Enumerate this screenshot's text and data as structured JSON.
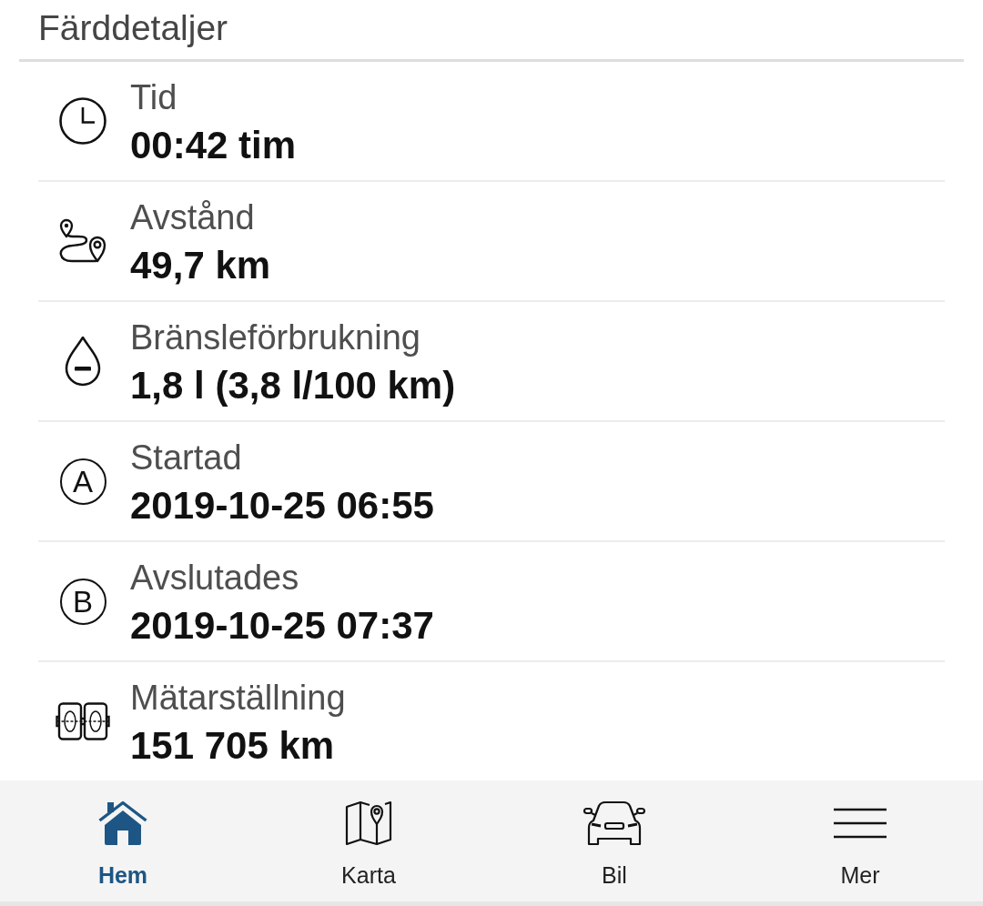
{
  "header": {
    "title": "Färddetaljer"
  },
  "details": [
    {
      "kind": "clock",
      "label": "Tid",
      "value": "00:42 tim"
    },
    {
      "kind": "route",
      "label": "Avstånd",
      "value": "49,7 km"
    },
    {
      "kind": "fuel",
      "label": "Bränsleförbrukning",
      "value": "1,8 l (3,8 l/100 km)"
    },
    {
      "kind": "marker",
      "marker": "A",
      "label": "Startad",
      "value": "2019-10-25 06:55"
    },
    {
      "kind": "marker",
      "marker": "B",
      "label": "Avslutades",
      "value": "2019-10-25 07:37"
    },
    {
      "kind": "odometer",
      "label": "Mätarställning",
      "value": "151 705 km"
    }
  ],
  "nav": [
    {
      "kind": "home",
      "label": "Hem",
      "selected": true
    },
    {
      "kind": "map",
      "label": "Karta",
      "selected": false
    },
    {
      "kind": "car",
      "label": "Bil",
      "selected": false
    },
    {
      "kind": "menu",
      "label": "Mer",
      "selected": false
    }
  ]
}
